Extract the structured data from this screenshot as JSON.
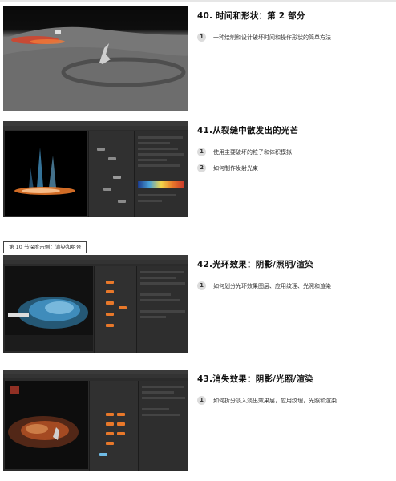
{
  "section_label": "第 10 节深度示例：渲染和组合",
  "lessons": [
    {
      "id": "l40",
      "title": "40. 时间和形状：第 2 部分",
      "bullets": [
        {
          "num": "1",
          "text": "一种绘制和设计破坏时间和操作形状的简单方法"
        }
      ]
    },
    {
      "id": "l41",
      "title": "41.从裂缝中散发出的光芒",
      "bullets": [
        {
          "num": "1",
          "text": "使用主要破坏的粒子和体积模拟"
        },
        {
          "num": "2",
          "text": "如何制作发射光束"
        }
      ]
    },
    {
      "id": "l42",
      "title": "42.光环效果：阴影/照明/渲染",
      "bullets": [
        {
          "num": "1",
          "text": "如何划分光环效果图层、应用纹理、光照和渲染"
        }
      ]
    },
    {
      "id": "l43",
      "title": "43.消失效果：阴影/光照/渲染",
      "bullets": [
        {
          "num": "1",
          "text": "如何拆分淡入淡出效果层，应用纹理，光照和渲染"
        }
      ]
    }
  ],
  "colors": {
    "accent_orange": "#e8782a",
    "ui_dark": "#2e2e2e",
    "glow_blue": "#4aa3d8"
  }
}
